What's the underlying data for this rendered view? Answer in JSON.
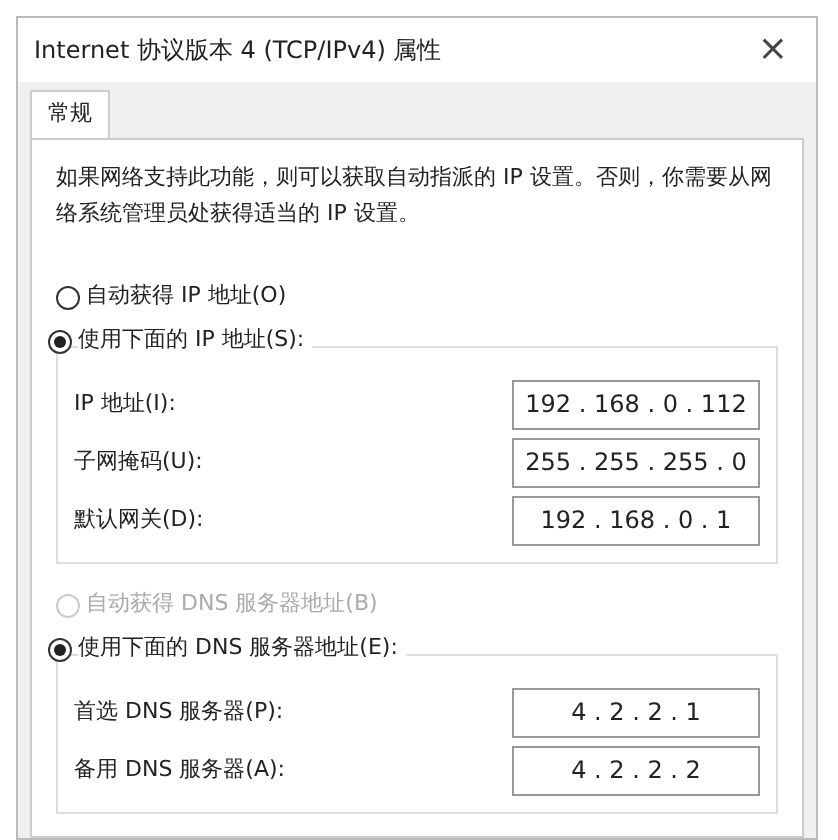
{
  "window": {
    "title": "Internet 协议版本 4 (TCP/IPv4) 属性",
    "close": "×"
  },
  "tabs": [
    {
      "label": "常规",
      "selected": true
    }
  ],
  "description": "如果网络支持此功能，则可以获取自动指派的 IP 设置。否则，你需要从网络系统管理员处获得适当的 IP 设置。",
  "sections": [
    {
      "options": [
        {
          "label": "自动获得 IP 地址(O)",
          "selected": false,
          "disabled": false
        },
        {
          "label": "使用下面的 IP 地址(S):",
          "selected": true,
          "disabled": false
        }
      ],
      "fields": [
        {
          "label": "IP 地址(I):",
          "value": "192 . 168 . 0 . 112"
        },
        {
          "label": "子网掩码(U):",
          "value": "255 . 255 . 255 . 0"
        },
        {
          "label": "默认网关(D):",
          "value": "192 . 168 . 0 . 1"
        }
      ]
    },
    {
      "options": [
        {
          "label": "自动获得 DNS 服务器地址(B)",
          "selected": false,
          "disabled": true
        },
        {
          "label": "使用下面的 DNS 服务器地址(E):",
          "selected": true,
          "disabled": false
        }
      ],
      "fields": [
        {
          "label": "首选 DNS 服务器(P):",
          "value": "4 . 2 . 2 . 1"
        },
        {
          "label": "备用 DNS 服务器(A):",
          "value": "4 . 2 . 2 . 2"
        }
      ]
    }
  ]
}
